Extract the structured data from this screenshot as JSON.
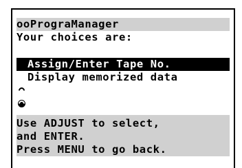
{
  "header": {
    "title": "ooPrograManager",
    "prompt": "Your choices are:"
  },
  "menu": {
    "items": [
      {
        "label": "Assign/Enter Tape No.",
        "selected": true
      },
      {
        "label": "Display memorized data",
        "selected": false
      }
    ]
  },
  "help": {
    "line1": "Use ADJUST to select,",
    "line2": "and ENTER.",
    "line3": "Press MENU to go back."
  }
}
